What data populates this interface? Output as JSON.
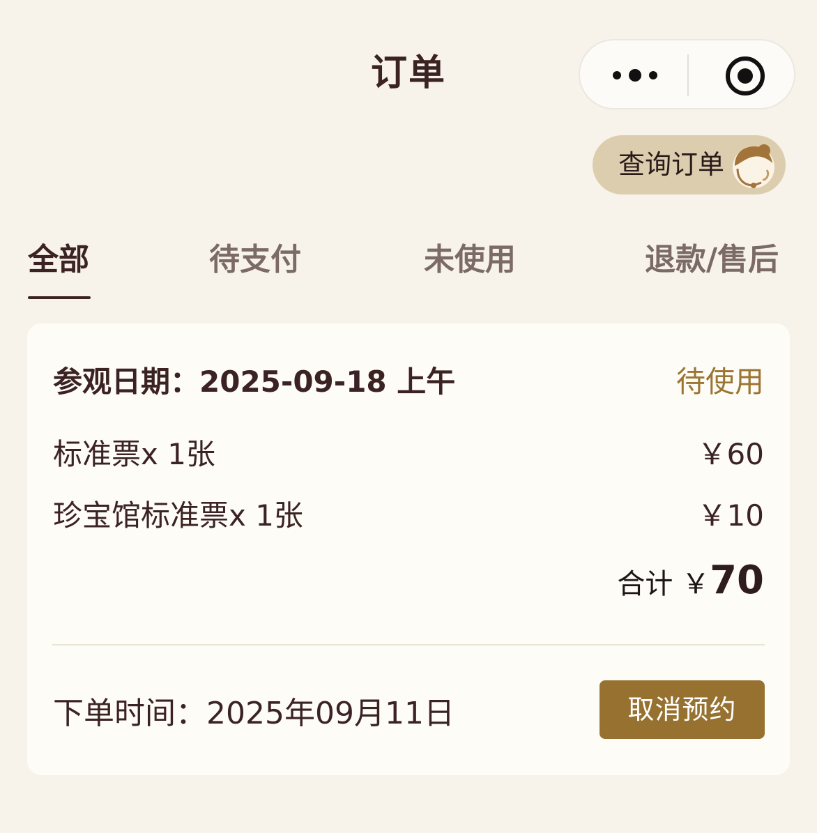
{
  "header": {
    "title": "订单"
  },
  "capsule": {
    "more_icon": "more-dots-icon",
    "close_icon": "target-close-icon"
  },
  "query": {
    "label": "查询订单",
    "icon": "customer-service-agent-icon"
  },
  "tabs": [
    {
      "label": "全部",
      "active": true
    },
    {
      "label": "待支付",
      "active": false
    },
    {
      "label": "未使用",
      "active": false
    },
    {
      "label": "退款/售后",
      "active": false
    }
  ],
  "order": {
    "visit_date": "参观日期：2025-09-18 上午",
    "status": "待使用",
    "items": [
      {
        "name": "标准票x 1张",
        "price": "￥60"
      },
      {
        "name": "珍宝馆标准票x 1张",
        "price": "￥10"
      }
    ],
    "total_label": "合计 ￥",
    "total_amount": "70",
    "order_time": "下单时间：2025年09月11日",
    "cancel_label": "取消预约"
  },
  "colors": {
    "background": "#f7f3ea",
    "card": "#fefcf7",
    "text": "#3b2323",
    "accent": "#96712f",
    "status": "#9b7533",
    "pill": "#dccdae"
  }
}
